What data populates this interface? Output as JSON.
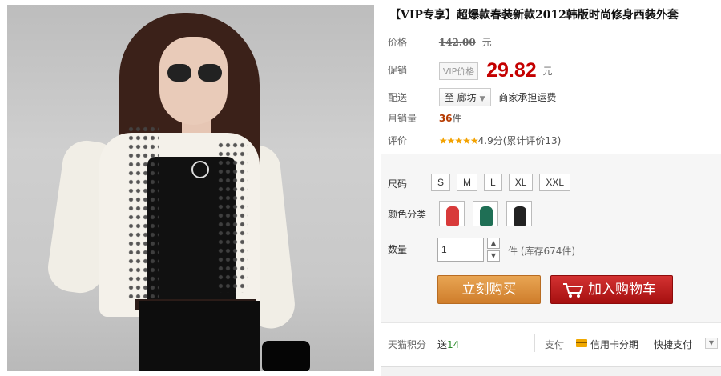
{
  "product": {
    "title": "【VIP专享】超爆款春装新款2012韩版时尚修身西装外套"
  },
  "price": {
    "label": "价格",
    "original": "142.00",
    "unit": "元"
  },
  "promo": {
    "label": "促销",
    "tag": "VIP价格",
    "price": "29.82",
    "unit": "元"
  },
  "shipping": {
    "label": "配送",
    "city": "至 廊坊",
    "note": "商家承担运费"
  },
  "sales": {
    "label": "月销量",
    "count": "36",
    "unit": "件"
  },
  "reviews": {
    "label": "评价",
    "stars": "★★★★★",
    "text": "4.9分(累计评价13)"
  },
  "size": {
    "label": "尺码",
    "options": [
      "S",
      "M",
      "L",
      "XL",
      "XXL"
    ]
  },
  "color": {
    "label": "颜色分类",
    "swatches": [
      "#d83a3a",
      "#1f6f55",
      "#222222"
    ]
  },
  "quantity": {
    "label": "数量",
    "value": "1",
    "stock": "件 (库存674件)"
  },
  "buttons": {
    "buy_now": "立刻购买",
    "add_to_cart": "加入购物车"
  },
  "points": {
    "label": "天猫积分",
    "prefix": "送",
    "value": "14"
  },
  "payment": {
    "label": "支付",
    "installment": "信用卡分期",
    "quickpay": "快捷支付"
  },
  "colors": {
    "promo_red": "#c40000",
    "buy_orange": "#cf7d2b",
    "cart_red": "#a61010"
  }
}
